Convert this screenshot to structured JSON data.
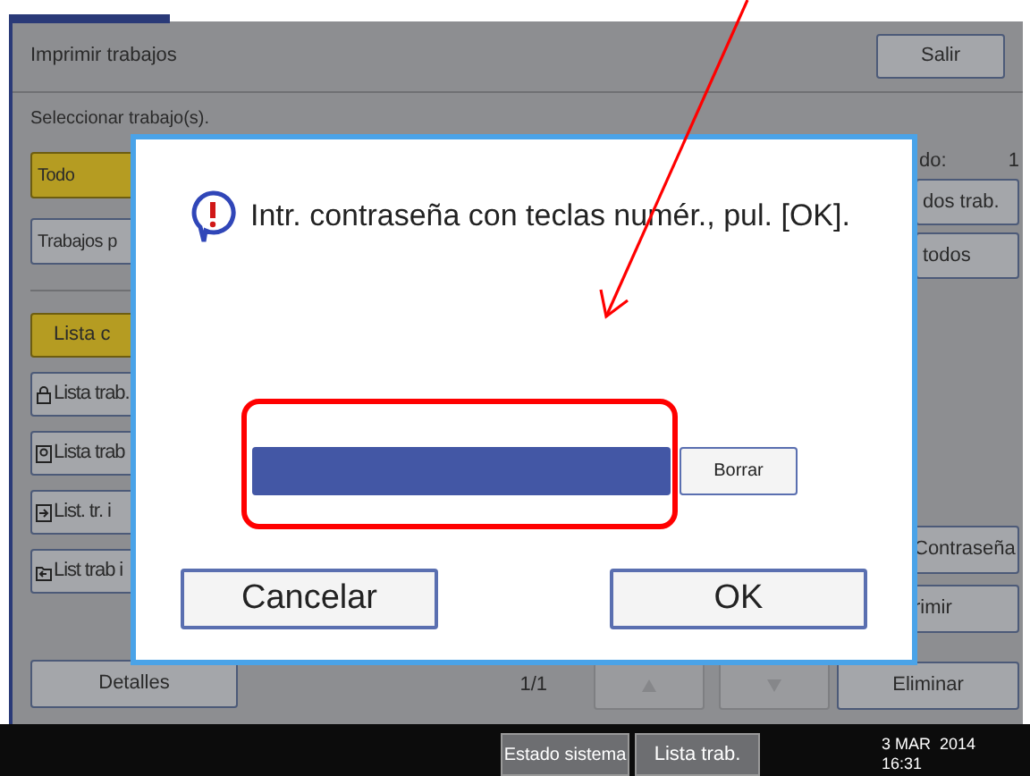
{
  "screen": {
    "title": "Imprimir trabajos",
    "exit_button": "Salir",
    "instruction": "Seleccionar trabajo(s).",
    "job_filters": [
      {
        "label": "Todo",
        "selected": true
      },
      {
        "label": "Trabajos p",
        "selected": false
      }
    ],
    "list_tabs": [
      {
        "label": "Lista c",
        "selected": true
      }
    ],
    "job_lists": [
      {
        "label": "Lista trab.",
        "kind": "locked"
      },
      {
        "label": "Lista trab",
        "kind": "sample"
      },
      {
        "label": "List. tr. i",
        "kind": "held"
      },
      {
        "label": "List trab i",
        "kind": "stored"
      }
    ],
    "count_label": "do:",
    "count": "1",
    "right_buttons": [
      "dos trab.",
      "todos"
    ],
    "lower_right_buttons": [
      "Contraseña",
      "rimir"
    ],
    "details_button": "Detalles",
    "page": "1/1",
    "nav_buttons": [
      {
        "kind": "up",
        "disabled": true
      },
      {
        "kind": "down",
        "disabled": true
      }
    ],
    "delete_button": "Eliminar"
  },
  "dialog": {
    "message": "Intr. contraseña con teclas numér., pul. [OK].",
    "clear_button": "Borrar",
    "buttons": [
      "Cancelar",
      "OK"
    ]
  },
  "status_bar": {
    "buttons": [
      "Estado sistema",
      "Lista trab."
    ],
    "date": "3 MAR  2014",
    "time": "16:31"
  }
}
